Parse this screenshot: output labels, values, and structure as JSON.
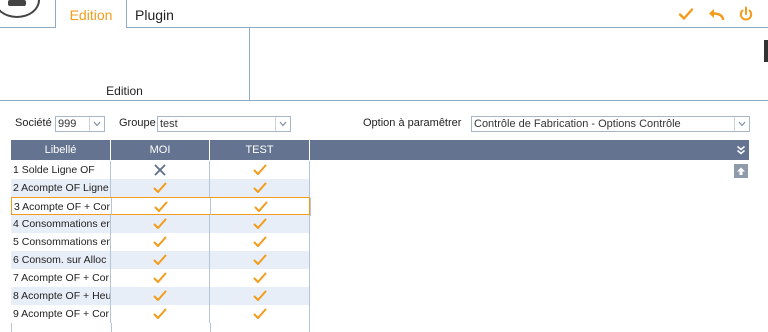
{
  "tabs": [
    {
      "label": "Edition",
      "active": true
    },
    {
      "label": "Plugin",
      "active": false
    }
  ],
  "toolbar_icons": [
    "checkmark-icon",
    "undo-arrow-icon",
    "power-icon"
  ],
  "ribbon": {
    "group_label": "Edition"
  },
  "filters": {
    "societe_label": "Société",
    "societe_value": "999",
    "groupe_label": "Groupe",
    "groupe_value": "test",
    "option_label": "Option à paramêtrer",
    "option_value": "Contrôle de Fabrication - Options Contrôle"
  },
  "grid": {
    "columns": [
      "Libellé",
      "MOI",
      "TEST"
    ],
    "rows": [
      {
        "label": "1 Solde Ligne OF",
        "moi": "cross",
        "test": "check"
      },
      {
        "label": "2 Acompte OF  Ligne",
        "moi": "check",
        "test": "check"
      },
      {
        "label": "3 Acompte OF + Cor",
        "moi": "check",
        "test": "check"
      },
      {
        "label": "4 Consommations en",
        "moi": "check",
        "test": "check"
      },
      {
        "label": "5 Consommations en",
        "moi": "check",
        "test": "check"
      },
      {
        "label": "6 Consom. sur Alloc",
        "moi": "check",
        "test": "check"
      },
      {
        "label": "7 Acompte OF + Cor",
        "moi": "check",
        "test": "check"
      },
      {
        "label": "8 Acompte OF + Heu",
        "moi": "check",
        "test": "check"
      },
      {
        "label": "9 Acompte OF + Cor",
        "moi": "check",
        "test": "check"
      }
    ],
    "selected_row": 2
  },
  "colors": {
    "accent": "#f39c1b",
    "header_bg": "#64738f",
    "row_alt": "#e8eef7",
    "cross": "#5a6f8c"
  }
}
